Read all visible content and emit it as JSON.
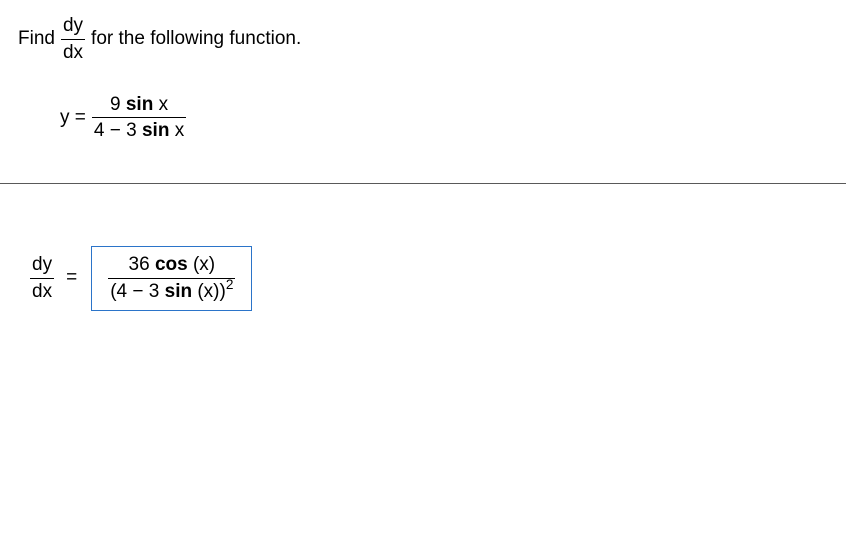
{
  "prompt": {
    "prefix": "Find",
    "frac_num": "dy",
    "frac_den": "dx",
    "suffix": "for the following function."
  },
  "function": {
    "lhs": "y =",
    "num": "9",
    "num_trig_fn": "sin",
    "num_var": "x",
    "den_a": "4",
    "den_op": "−",
    "den_b": "3",
    "den_trig_fn": "sin",
    "den_var": "x"
  },
  "answer": {
    "lhs_num": "dy",
    "lhs_den": "dx",
    "equals": "=",
    "num_coeff": "36",
    "num_trig_fn": "cos",
    "num_arg": "(x)",
    "den_a": "(4",
    "den_op": "−",
    "den_b": "3",
    "den_trig_fn": "sin",
    "den_arg": "(x))",
    "den_exp": "2"
  }
}
